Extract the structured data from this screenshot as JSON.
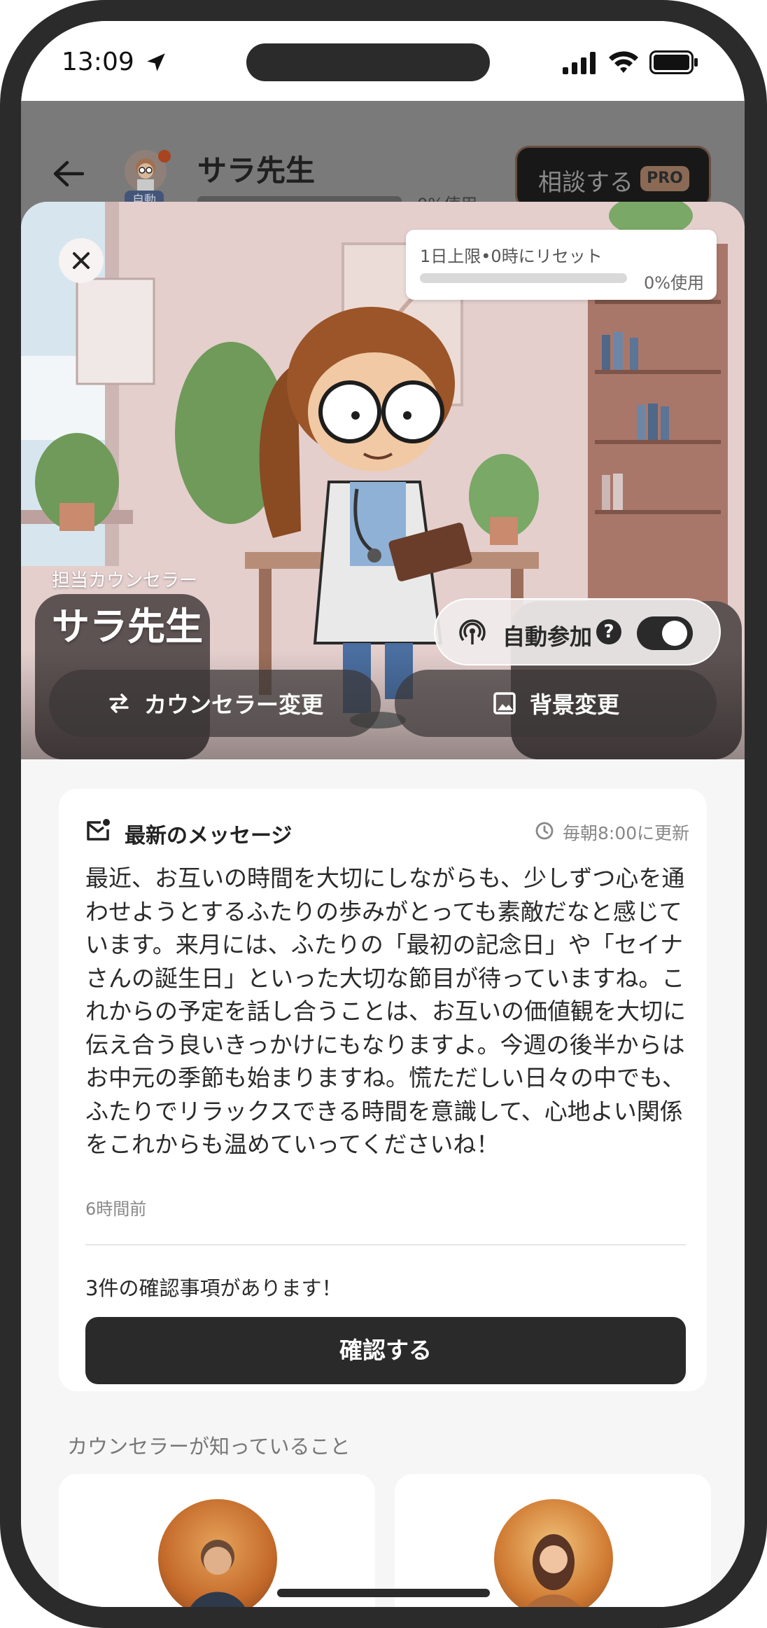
{
  "status_bar": {
    "time": "13:09"
  },
  "header": {
    "avatar_badge": "自動",
    "name": "サラ先生",
    "usage": "0%使用",
    "usage_fraction": 0,
    "consult_button": "相談する",
    "pro_badge": "PRO"
  },
  "sheet": {
    "limit_card": {
      "title": "1日上限•0時にリセット",
      "usage": "0%使用",
      "usage_fraction": 0
    },
    "role_label": "担当カウンセラー",
    "counselor_name": "サラ先生",
    "auto_join": {
      "label": "自動参加",
      "help": "?",
      "enabled": true
    },
    "buttons": {
      "change_counselor": "カウンセラー変更",
      "change_background": "背景変更"
    }
  },
  "message_card": {
    "title": "最新のメッセージ",
    "update_schedule": "毎朝8:00に更新",
    "body": "最近、お互いの時間を大切にしながらも、少しずつ心を通わせようとするふたりの歩みがとっても素敵だなと感じています。来月には、ふたりの「最初の記念日」や「セイナさんの誕生日」といった大切な節目が待っていますね。これからの予定を話し合うことは、お互いの価値観を大切に伝え合う良いきっかけにもなりますよ。今週の後半からはお中元の季節も始まりますね。慌ただしい日々の中でも、ふたりでリラックスできる時間を意識して、心地よい関係をこれからも温めていってくださいね！",
    "posted": "6時間前",
    "pending": "3件の確認事項があります！",
    "confirm_button": "確認する"
  },
  "knows_section": {
    "title": "カウンセラーが知っていること"
  },
  "colors": {
    "primary": "#2a2a2a",
    "accent_brown": "#8a6a55",
    "background": "#f6f6f6"
  }
}
